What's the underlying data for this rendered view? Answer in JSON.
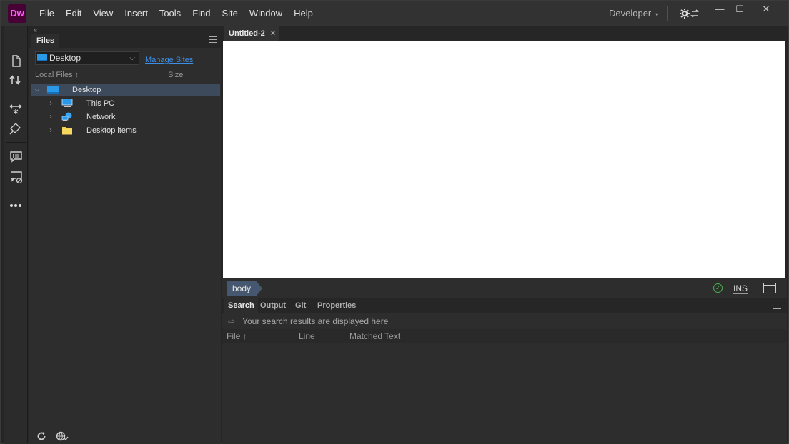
{
  "app": {
    "logo": "Dw"
  },
  "menu": [
    "File",
    "Edit",
    "View",
    "Insert",
    "Tools",
    "Find",
    "Site",
    "Window",
    "Help"
  ],
  "workspace": {
    "label": "Developer",
    "caret": "▾"
  },
  "window_controls": {
    "minimize": "—",
    "maximize": "☐",
    "close": "✕"
  },
  "files_panel": {
    "collapse": "«",
    "tab": "Files",
    "site_select": "Desktop",
    "manage_sites": "Manage Sites",
    "col_local": "Local Files ↑",
    "col_size": "Size",
    "tree": [
      {
        "label": "Desktop",
        "arrow": "⌵",
        "icon": "desktop-icon",
        "selected": true
      },
      {
        "label": "This PC",
        "arrow": "›",
        "icon": "computer-icon"
      },
      {
        "label": "Network",
        "arrow": "›",
        "icon": "network-icon"
      },
      {
        "label": "Desktop items",
        "arrow": "›",
        "icon": "folder-icon"
      }
    ]
  },
  "document": {
    "tab": "Untitled-2",
    "tab_close": "×",
    "tag_chip": "body",
    "ins": "INS"
  },
  "output_panel": {
    "tabs": [
      "Search",
      "Output",
      "Git",
      "Properties"
    ],
    "active_tab": "Search",
    "message": "Your search results are displayed here",
    "columns": [
      "File ↑",
      "Line",
      "Matched Text"
    ]
  },
  "colors": {
    "accent_link": "#3d8fe6",
    "logo_bg": "#470137",
    "logo_fg": "#ff61f6",
    "selected_row": "#3d4a5c"
  }
}
